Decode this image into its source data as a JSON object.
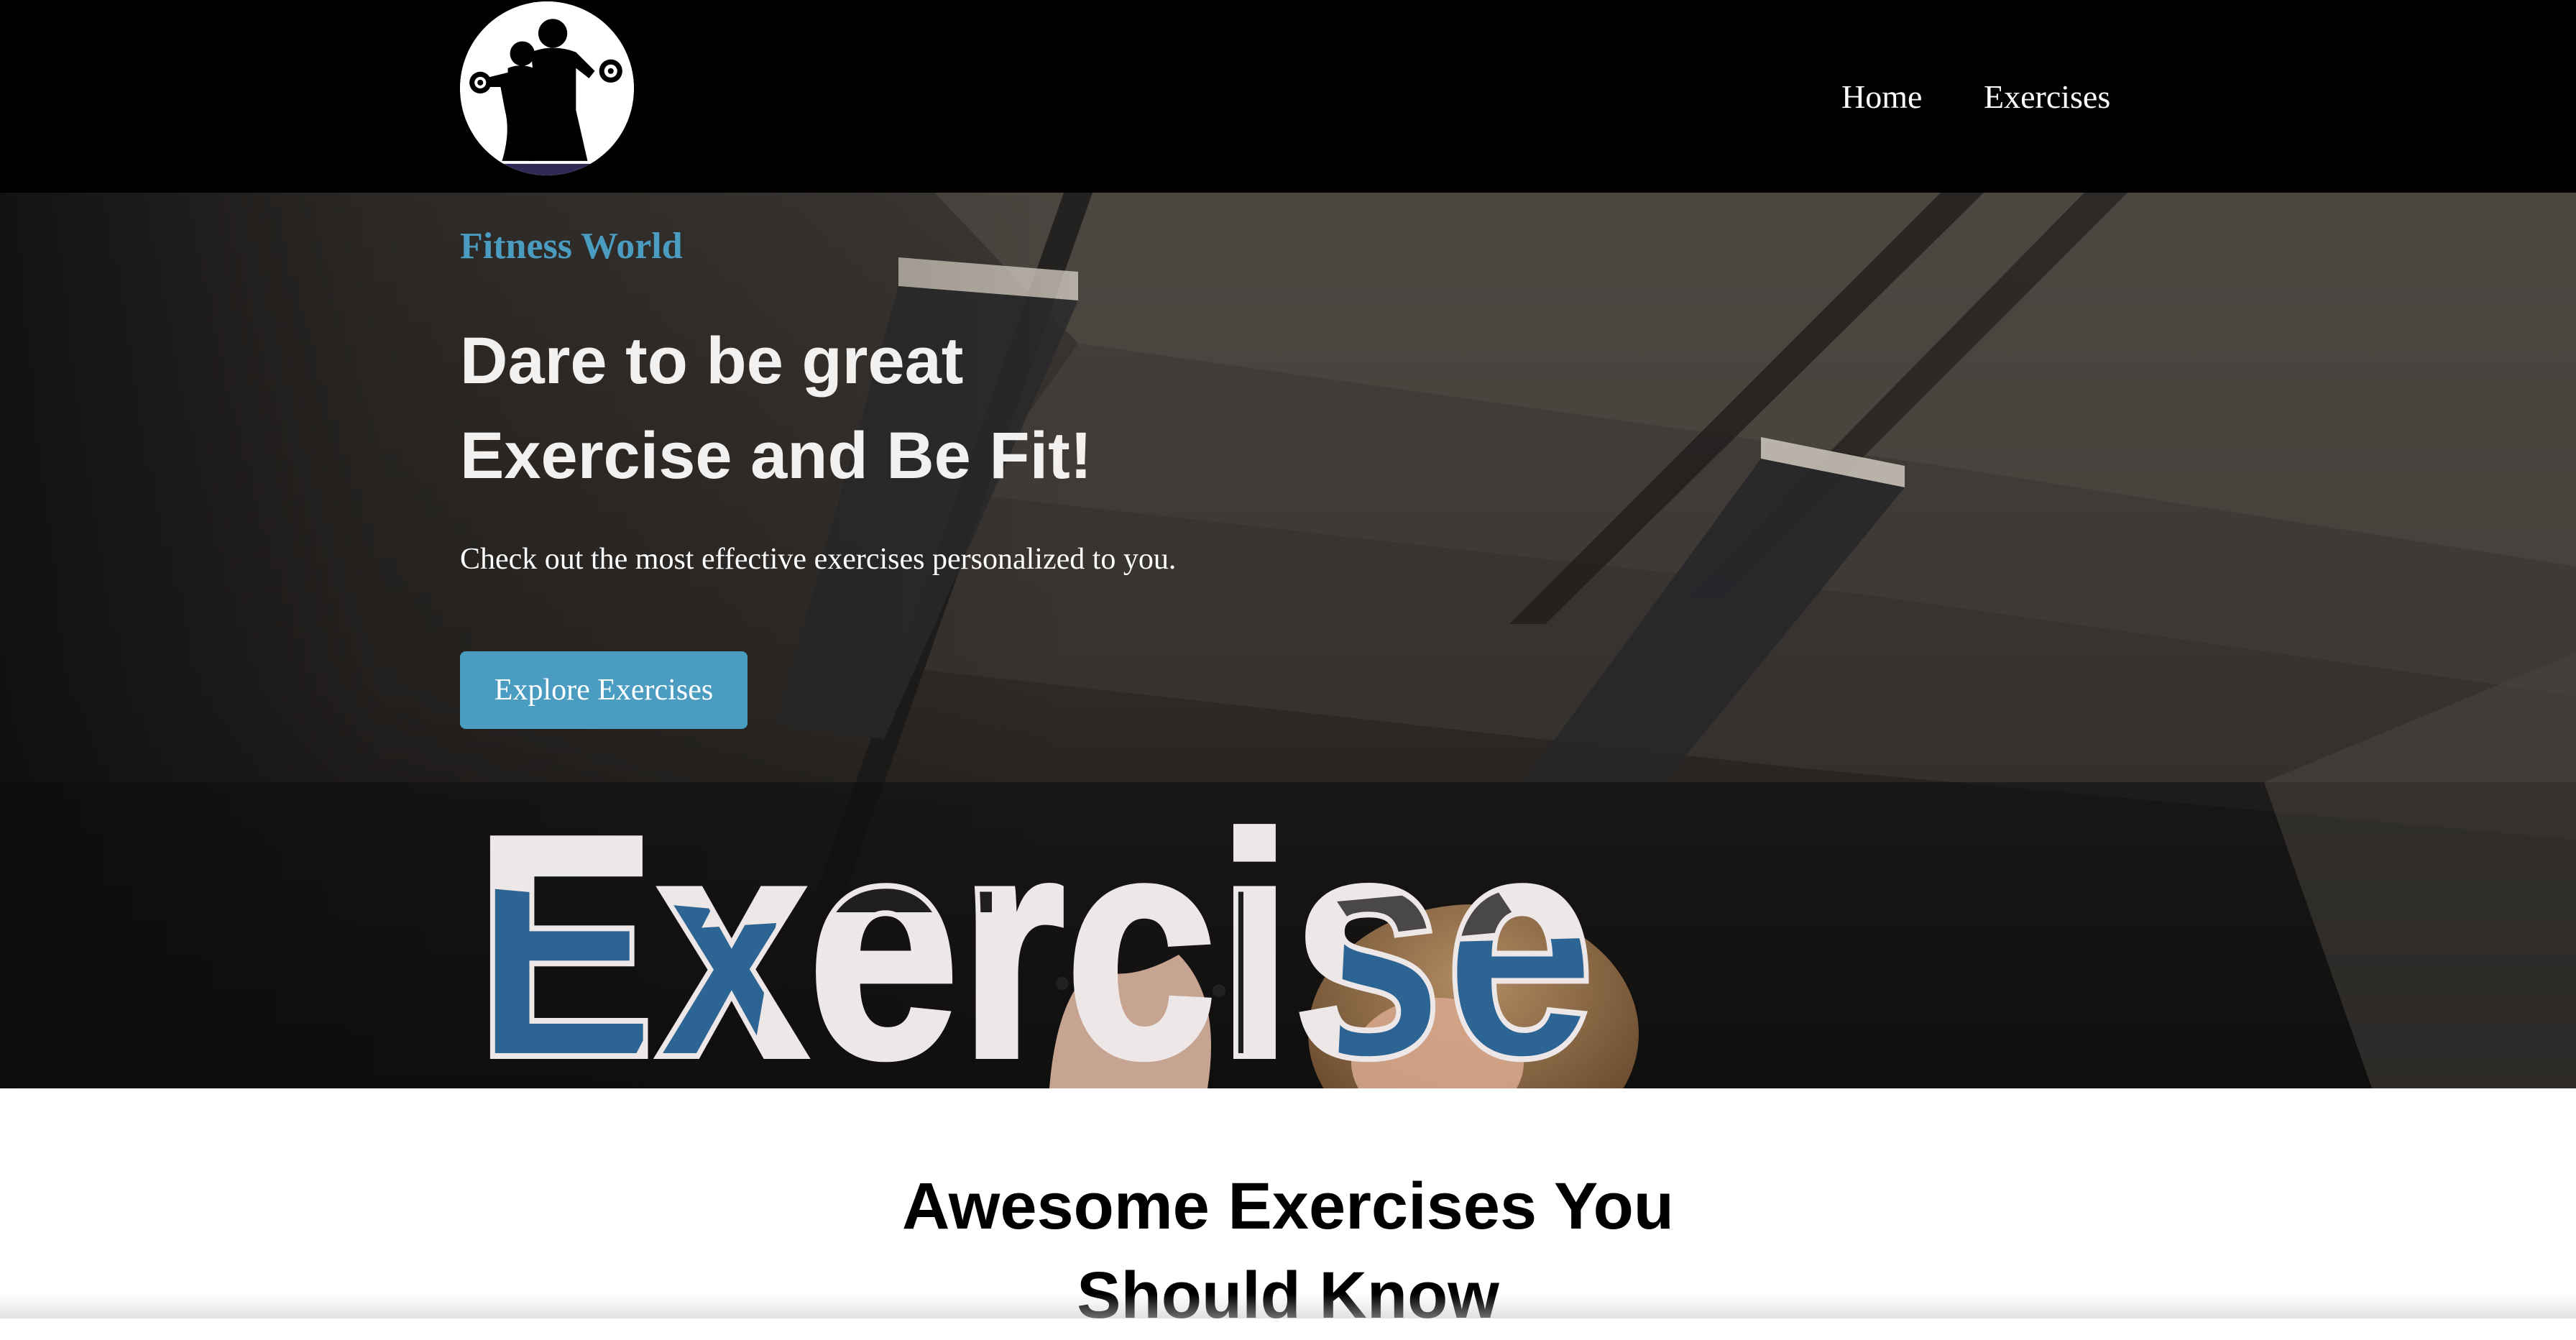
{
  "navbar": {
    "logo_icon": "fitness-couple-dumbbells-logo",
    "links": [
      {
        "label": "Home"
      },
      {
        "label": "Exercises"
      }
    ]
  },
  "hero": {
    "brand": "Fitness World",
    "headline_line1": "Dare to be great",
    "headline_line2": "Exercise and Be Fit!",
    "subtext": "Check out the most effective exercises personalized to you.",
    "cta_label": "Explore Exercises",
    "banner_text": "Exercise",
    "background_image": "gym-ceiling-woman-photo"
  },
  "section": {
    "title_line1": "Awesome Exercises You",
    "title_line2": "Should Know"
  },
  "colors": {
    "accent": "#4a9cc1",
    "navbar_bg": "#000000",
    "banner_letter_fill": "#ede7e8",
    "banner_accent": "#2c6494"
  }
}
